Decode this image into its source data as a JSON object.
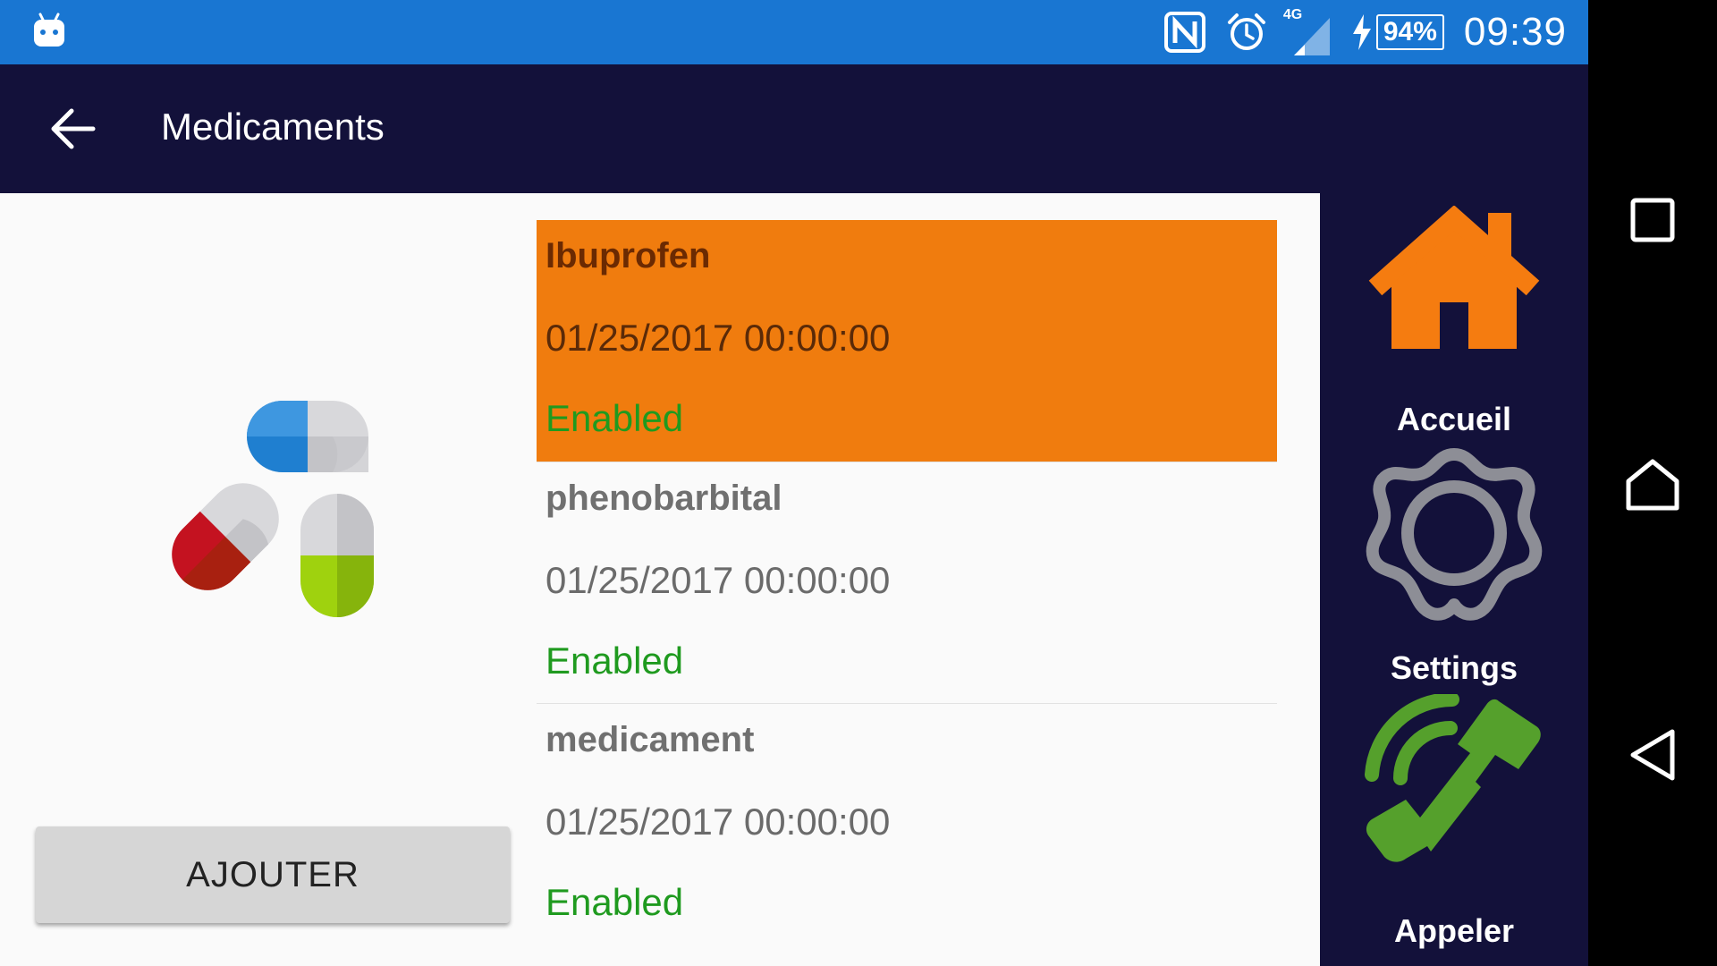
{
  "status_bar": {
    "network_label": "4G",
    "battery": "94%",
    "time": "09:39",
    "icons": [
      "android-icon",
      "nfc-icon",
      "alarm-icon",
      "signal-icon",
      "charging-icon"
    ]
  },
  "app_bar": {
    "title": "Medicaments",
    "back_icon": "arrow-left-icon"
  },
  "main": {
    "image_icon": "pills-icon",
    "add_button_label": "AJOUTER",
    "medications": [
      {
        "name": "Ibuprofen",
        "date": "01/25/2017 00:00:00",
        "status": "Enabled",
        "selected": true
      },
      {
        "name": "phenobarbital",
        "date": "01/25/2017 00:00:00",
        "status": "Enabled",
        "selected": false
      },
      {
        "name": "medicament",
        "date": "01/25/2017 00:00:00",
        "status": "Enabled",
        "selected": false
      }
    ]
  },
  "side_nav": {
    "items": [
      {
        "label": "Accueil",
        "icon": "home-icon"
      },
      {
        "label": "Settings",
        "icon": "gear-icon"
      },
      {
        "label": "Appeler",
        "icon": "phone-icon"
      }
    ]
  },
  "colors": {
    "status_bar": "#1976d2",
    "app_bar": "#13113a",
    "selected_item": "#f07c0e",
    "enabled_text": "#1f9a1f",
    "home_icon": "#f57c10",
    "phone_icon": "#55a02c"
  }
}
